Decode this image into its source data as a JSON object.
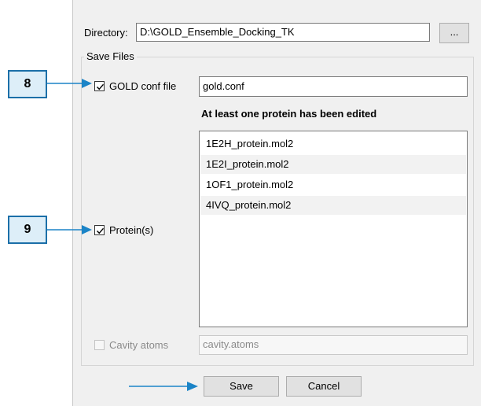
{
  "directory": {
    "label": "Directory:",
    "value": "D:\\GOLD_Ensemble_Docking_TK",
    "browse_label": "..."
  },
  "save_files": {
    "title": "Save Files",
    "gold_conf": {
      "label": "GOLD conf file",
      "value": "gold.conf",
      "checked": true
    },
    "edited_notice": "At least one protein has been edited",
    "proteins": {
      "label": "Protein(s)",
      "checked": true,
      "items": [
        "1E2H_protein.mol2",
        "1E2I_protein.mol2",
        "1OF1_protein.mol2",
        "4IVQ_protein.mol2"
      ]
    },
    "cavity": {
      "label": "Cavity atoms",
      "value": "cavity.atoms",
      "checked": false,
      "enabled": false
    }
  },
  "buttons": {
    "save_label": "Save",
    "cancel_label": "Cancel"
  },
  "callouts": {
    "c8": "8",
    "c9": "9"
  },
  "colors": {
    "callout_fill": "#ddeef8",
    "callout_border": "#1b6fa8",
    "arrow": "#1b84c7"
  }
}
